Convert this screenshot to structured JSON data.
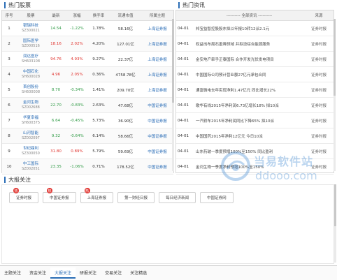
{
  "hot_stocks": {
    "title": "热门股票",
    "columns": [
      "序号",
      "股票",
      "最新",
      "涨幅",
      "换手率",
      "流通市值",
      "所属主题"
    ],
    "rows": [
      {
        "no": "1",
        "name": "银瑞科技",
        "code": "SZ300021",
        "price": "14.54",
        "change": "-1.22%",
        "dir": "down",
        "turnover": "1.78%",
        "cap": "58.16亿",
        "theme": "上海证券报"
      },
      {
        "no": "2",
        "name": "国际医学",
        "code": "SZ000516",
        "price": "18.16",
        "change": "2.02%",
        "dir": "up",
        "turnover": "4.20%",
        "cap": "127.01亿",
        "theme": "上海证券报"
      },
      {
        "no": "3",
        "name": "润达医疗",
        "code": "SH603108",
        "price": "94.76",
        "change": "4.93%",
        "dir": "up",
        "turnover": "9.27%",
        "cap": "22.37亿",
        "theme": "上海证券报"
      },
      {
        "no": "4",
        "name": "中国石化",
        "code": "SH600028",
        "price": "4.96",
        "change": "2.05%",
        "dir": "up",
        "turnover": "0.36%",
        "cap": "4758.78亿",
        "theme": "上海证券报"
      },
      {
        "no": "5",
        "name": "首创股份",
        "code": "SH600008",
        "price": "8.70",
        "change": "-0.34%",
        "dir": "down",
        "turnover": "1.41%",
        "cap": "209.70亿",
        "theme": "上海证券报"
      },
      {
        "no": "6",
        "name": "金河生物",
        "code": "SZ002688",
        "price": "22.70",
        "change": "-0.83%",
        "dir": "down",
        "turnover": "2.63%",
        "cap": "47.68亿",
        "theme": "中国证券报"
      },
      {
        "no": "7",
        "name": "华夏幸福",
        "code": "SH600375",
        "price": "6.64",
        "change": "-0.45%",
        "dir": "down",
        "turnover": "5.73%",
        "cap": "36.90亿",
        "theme": "中国证券报"
      },
      {
        "no": "8",
        "name": "山河智能",
        "code": "SZ002097",
        "price": "9.32",
        "change": "-0.64%",
        "dir": "down",
        "turnover": "6.14%",
        "cap": "58.66亿",
        "theme": "中国证券报"
      },
      {
        "no": "9",
        "name": "世纪鼎利",
        "code": "SZ300050",
        "price": "31.80",
        "change": "0.89%",
        "dir": "up",
        "turnover": "5.79%",
        "cap": "59.69亿",
        "theme": "中国证券报"
      },
      {
        "no": "10",
        "name": "中工国际",
        "code": "SZ002051",
        "price": "23.35",
        "change": "-1.06%",
        "dir": "down",
        "turnover": "0.71%",
        "cap": "178.52亿",
        "theme": "中国证券报"
      }
    ]
  },
  "hot_news": {
    "title": "热门资讯",
    "columns": [
      "---------- 全部资讯 ----------",
      "来源"
    ],
    "rows": [
      {
        "date": "04-01",
        "title": "邦宝益智控股股东拟以年报10转12派2.1元",
        "source": "证券时报"
      },
      {
        "date": "04-01",
        "title": "权益出布局石墨烯领域 并拟设综合能源服务",
        "source": "证券时报"
      },
      {
        "date": "04-01",
        "title": "金安地产牵手正泰国际 合作开发光伏发电项目",
        "source": "证券时报"
      },
      {
        "date": "04-01",
        "title": "中国国际公司预计营业额27亿元承包合同",
        "source": "证券时报"
      },
      {
        "date": "04-01",
        "title": "通富微电去年实现净利1.47亿元 同比增长22%",
        "source": "证券时报"
      },
      {
        "date": "04-01",
        "title": "歌华有线2015年净利润6.73亿增长18% 拟10派",
        "source": "证券时报"
      },
      {
        "date": "04-01",
        "title": "一汽轿车2015年净利润同比下降65% 拟10派",
        "source": "证券时报"
      },
      {
        "date": "04-01",
        "title": "中国国药2015年净利12亿元 今日10派",
        "source": "证券时报"
      },
      {
        "date": "04-01",
        "title": "山东药玻一季度预增100%至150% 同比盈利",
        "source": "证券时报"
      },
      {
        "date": "04-01",
        "title": "金河生物一季度净利预增100%至150%",
        "source": "证券时报"
      }
    ]
  },
  "newspapers": {
    "title": "大报关注",
    "items": [
      {
        "label": "证券时报",
        "hot": true
      },
      {
        "label": "中国证券报",
        "hot": true
      },
      {
        "label": "上海证券报",
        "hot": true
      },
      {
        "label": "第一财经日报",
        "hot": false
      },
      {
        "label": "每日经济新闻",
        "hot": false
      },
      {
        "label": "中国证券网",
        "hot": false
      }
    ],
    "hot_mark": "热"
  },
  "tabs": {
    "items": [
      "主题关注",
      "资金关注",
      "大报关注",
      "研报关注",
      "交易关注",
      "关注精选"
    ],
    "active_index": 2
  },
  "watermark": {
    "text_cn": "当易软件站",
    "text_en": "ddooo.com"
  },
  "colors": {
    "up": "#e0322d",
    "down": "#2f9a45",
    "link": "#2a6db6"
  }
}
